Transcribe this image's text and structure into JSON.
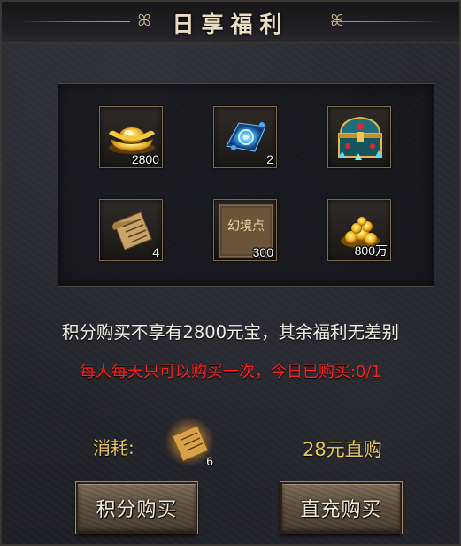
{
  "title": "日享福利",
  "rewards": [
    {
      "icon": "gold-ingot-icon",
      "count": "2800"
    },
    {
      "icon": "blue-scroll-icon",
      "count": "2"
    },
    {
      "icon": "treasure-chest-icon",
      "count": ""
    },
    {
      "icon": "paper-scroll-icon",
      "count": "4"
    },
    {
      "icon": "illusion-points-token-icon",
      "icon_text": "幻境点",
      "count": "300"
    },
    {
      "icon": "gold-coins-icon",
      "count": "800万"
    }
  ],
  "note": "积分购买不享有2800元宝，其余福利无差别",
  "limit": "每人每天只可以购买一次，今日已购买:0/1",
  "cost": {
    "label": "消耗:",
    "item_icon": "golden-scroll-icon",
    "item_count": "6"
  },
  "price_text": "28元直购",
  "buttons": {
    "points_buy": "积分购买",
    "direct_buy": "直充购买"
  },
  "colors": {
    "limit_text": "#ff1e1e",
    "gold_text": "#e6c65a",
    "title_text": "#e9dcc0"
  }
}
